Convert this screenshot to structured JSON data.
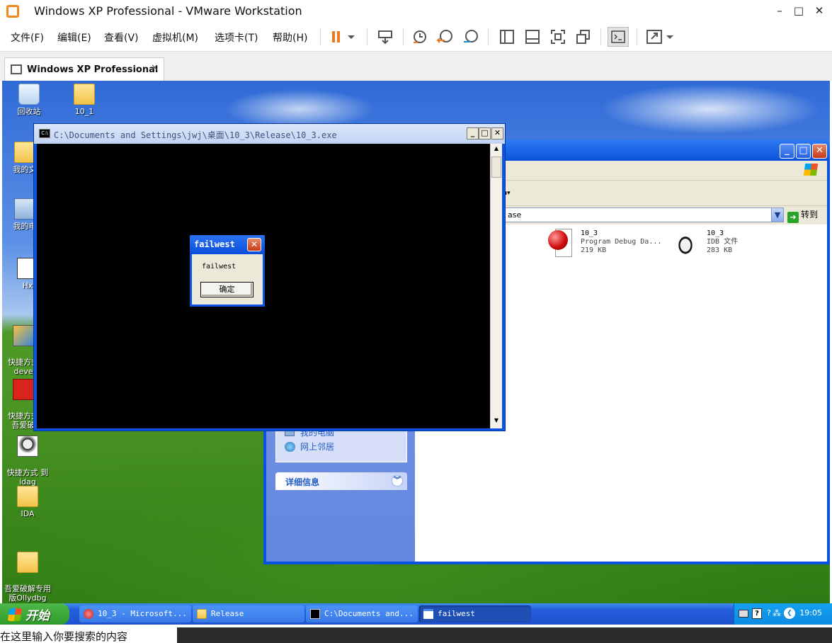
{
  "host": {
    "title": "Windows XP Professional - VMware Workstation",
    "menu": [
      "文件(F)",
      "编辑(E)",
      "查看(V)",
      "虚拟机(M)",
      "选项卡(T)",
      "帮助(H)"
    ],
    "tab_label": "Windows XP Professional",
    "bottom_text": "在这里输入你要搜索的内容"
  },
  "desktop": {
    "icons": [
      {
        "label": "回收站"
      },
      {
        "label": "10_1"
      },
      {
        "label": "我的文"
      },
      {
        "label": "我的电"
      },
      {
        "label": "Hx"
      },
      {
        "label": "快捷方式\ndeve"
      },
      {
        "label": "快捷方式\n吾爱破"
      },
      {
        "label": "快捷方式 到\nidag"
      },
      {
        "label": "IDA"
      },
      {
        "label": "吾爱破解专用\n版Ollydbg"
      }
    ]
  },
  "explorer": {
    "address_value": "ase",
    "go_label": "转到",
    "left_links": [
      "我的电脑",
      "网上邻居"
    ],
    "details_header": "详细信息",
    "files": [
      {
        "name": "10_3",
        "type": "Program Debug Da...",
        "size": "219 KB"
      },
      {
        "name": "10_3",
        "type": "IDB 文件",
        "size": "283 KB"
      }
    ]
  },
  "console": {
    "title": "C:\\Documents and Settings\\jwj\\桌面\\10_3\\Release\\10_3.exe"
  },
  "msgbox": {
    "title": "failwest",
    "text": "failwest",
    "ok_label": "确定"
  },
  "taskbar": {
    "start_label": "开始",
    "tasks": [
      {
        "label": "10_3 - Microsoft..."
      },
      {
        "label": "Release"
      },
      {
        "label": "C:\\Documents and..."
      },
      {
        "label": "failwest"
      }
    ],
    "clock": "19:05"
  },
  "colors": {
    "xp_blue": "#0a55e3",
    "start_green": "#2f9a2c",
    "tray_blue": "#0c8ae1"
  }
}
